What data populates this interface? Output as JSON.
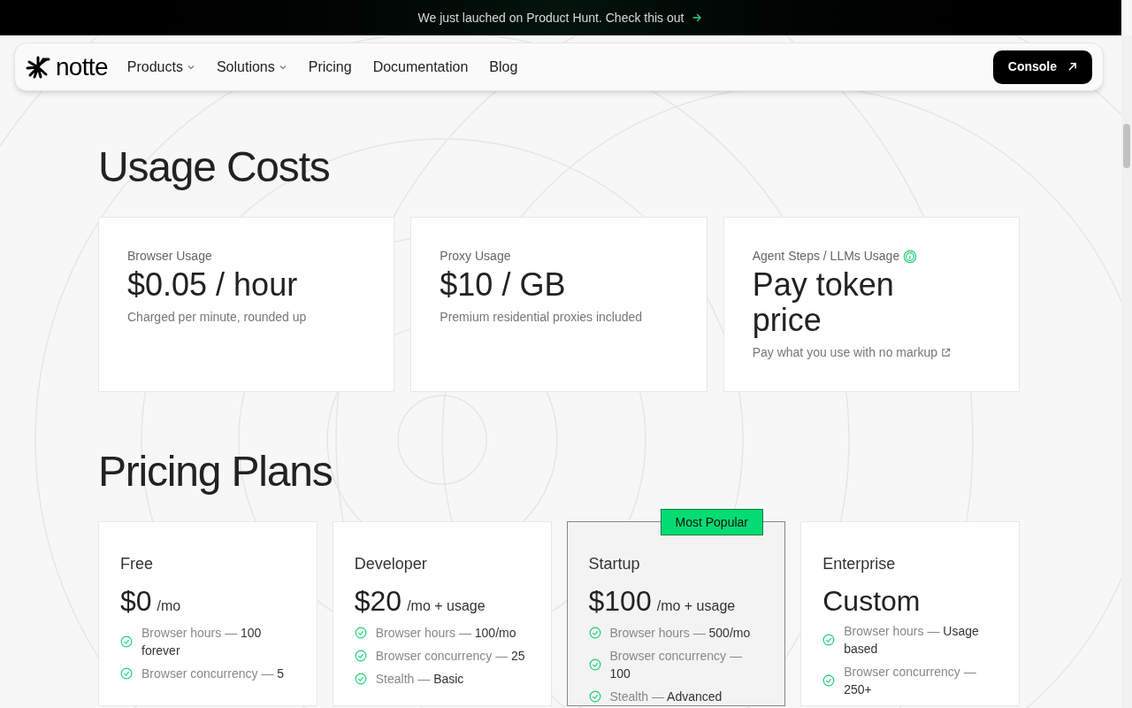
{
  "announcement": {
    "text": "We just lauched on Product Hunt. Check this out"
  },
  "nav": {
    "logo": "notte",
    "items": [
      {
        "label": "Products",
        "kind": "dropdown"
      },
      {
        "label": "Solutions",
        "kind": "dropdown"
      },
      {
        "label": "Pricing",
        "kind": "link"
      },
      {
        "label": "Documentation",
        "kind": "link"
      },
      {
        "label": "Blog",
        "kind": "link"
      }
    ],
    "cta": "Console"
  },
  "usage": {
    "title": "Usage Costs",
    "cards": [
      {
        "label": "Browser Usage",
        "price": "$0.05 / hour",
        "note": "Charged per minute, rounded up",
        "info": false,
        "external": false
      },
      {
        "label": "Proxy Usage",
        "price": "$10 / GB",
        "note": "Premium residential proxies included",
        "info": false,
        "external": false
      },
      {
        "label": "Agent Steps / LLMs Usage",
        "price": "Pay token price",
        "note": "Pay what you use with no markup",
        "info": true,
        "external": true
      }
    ]
  },
  "plans": {
    "title": "Pricing Plans",
    "cards": [
      {
        "name": "Free",
        "price": "$0",
        "unit": "/mo",
        "featured": false,
        "features": [
          {
            "label": "Browser hours —",
            "value": "100 forever"
          },
          {
            "label": "Browser concurrency —",
            "value": "5"
          }
        ]
      },
      {
        "name": "Developer",
        "price": "$20",
        "unit": "/mo + usage",
        "featured": false,
        "features": [
          {
            "label": "Browser hours —",
            "value": "100/mo"
          },
          {
            "label": "Browser concurrency —",
            "value": "25"
          },
          {
            "label": "Stealth —",
            "value": "Basic"
          }
        ]
      },
      {
        "name": "Startup",
        "price": "$100",
        "unit": "/mo + usage",
        "featured": true,
        "badge": "Most Popular",
        "features": [
          {
            "label": "Browser hours —",
            "value": "500/mo"
          },
          {
            "label": "Browser concurrency —",
            "value": "100"
          },
          {
            "label": "Stealth —",
            "value": "Advanced"
          }
        ]
      },
      {
        "name": "Enterprise",
        "price": "Custom",
        "featured": false,
        "features": [
          {
            "label": "Browser hours —",
            "value": "Usage based"
          },
          {
            "label": "Browser concurrency —",
            "value": "250+"
          }
        ]
      }
    ]
  }
}
